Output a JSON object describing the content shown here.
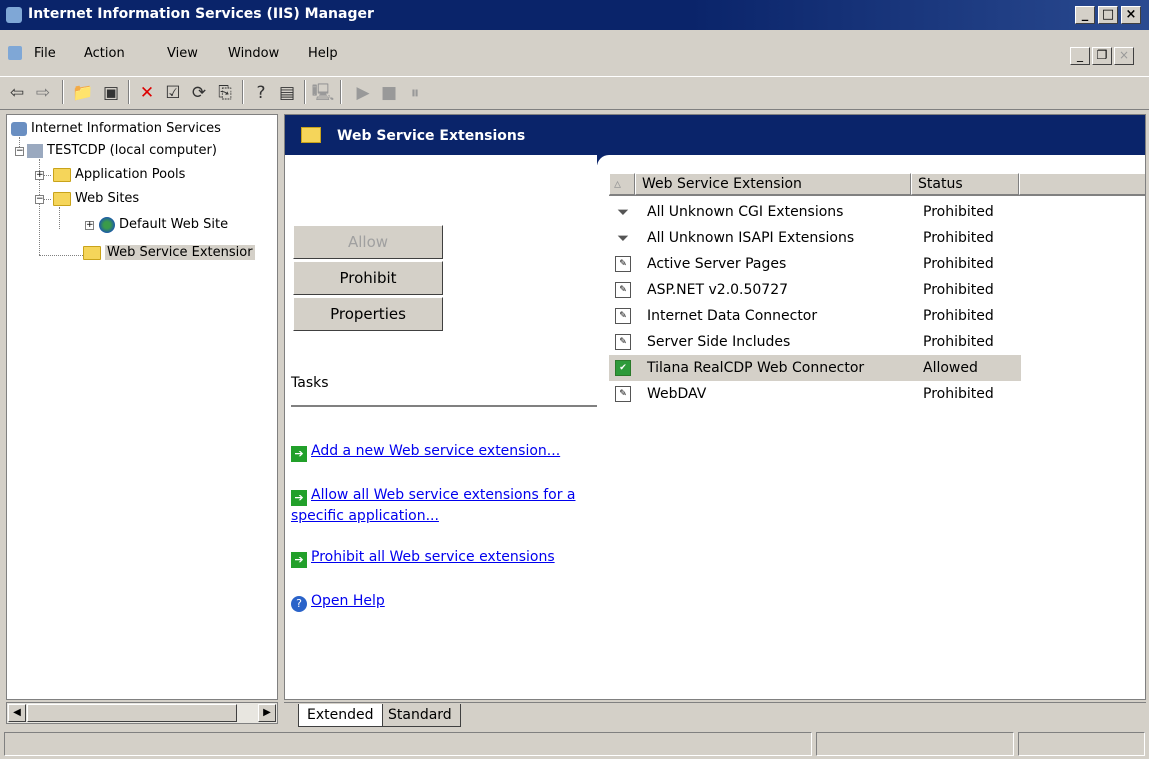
{
  "window": {
    "title": "Internet Information Services (IIS) Manager"
  },
  "menu": {
    "items": [
      "File",
      "Action",
      "View",
      "Window",
      "Help"
    ]
  },
  "toolbar": {
    "icons": [
      "back-icon",
      "forward-icon",
      "up-folder-icon",
      "show-hide-tree-icon",
      "delete-icon",
      "properties-icon",
      "refresh-icon",
      "export-list-icon",
      "help-icon",
      "show-hide-action-pane-icon",
      "computer-icon",
      "play-icon",
      "stop-icon",
      "pause-icon"
    ]
  },
  "tree": {
    "root": "Internet Information Services",
    "computer": "TESTCDP (local computer)",
    "app_pools": "Application Pools",
    "web_sites": "Web Sites",
    "default_site": "Default Web Site",
    "wse": "Web Service Extensior"
  },
  "panel": {
    "title": "Web Service Extensions",
    "buttons": {
      "allow": "Allow",
      "prohibit": "Prohibit",
      "properties": "Properties"
    },
    "tasks_label": "Tasks",
    "tasks": {
      "add": "Add a new Web service extension...",
      "allow_all": "Allow all Web service extensions for a specific application...",
      "prohibit_all": "Prohibit all Web service extensions",
      "help": "Open Help"
    }
  },
  "list": {
    "columns": {
      "name": "Web Service Extension",
      "status": "Status"
    },
    "rows": [
      {
        "name": "All Unknown CGI Extensions",
        "status": "Prohibited"
      },
      {
        "name": "All Unknown ISAPI Extensions",
        "status": "Prohibited"
      },
      {
        "name": "Active Server Pages",
        "status": "Prohibited"
      },
      {
        "name": "ASP.NET v2.0.50727",
        "status": "Prohibited"
      },
      {
        "name": "Internet Data Connector",
        "status": "Prohibited"
      },
      {
        "name": "Server Side Includes",
        "status": "Prohibited"
      },
      {
        "name": "Tilana RealCDP Web Connector",
        "status": "Allowed"
      },
      {
        "name": "WebDAV",
        "status": "Prohibited"
      }
    ]
  },
  "tabs": {
    "extended": "Extended",
    "standard": "Standard"
  },
  "colors": {
    "titlebar": "#0a246a",
    "face": "#d4d0c8",
    "link": "#0000ee"
  }
}
